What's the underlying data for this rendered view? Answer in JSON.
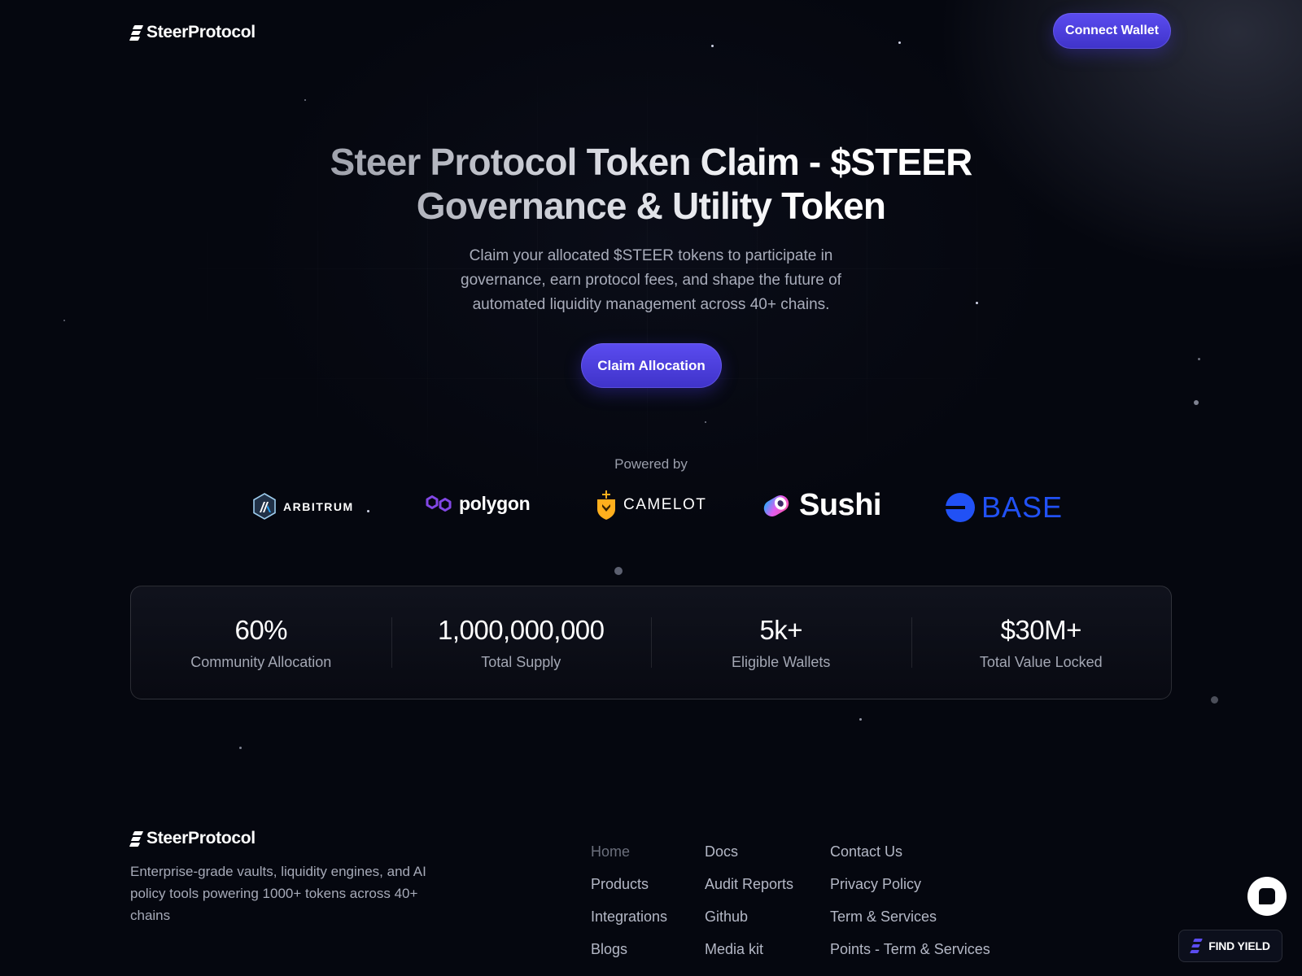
{
  "header": {
    "logo_text": "SteerProtocol",
    "connect_label": "Connect Wallet"
  },
  "hero": {
    "title_line1": "Steer Protocol Token Claim - $STEER",
    "title_line2": "Governance & Utility Token",
    "subtitle": "Claim your allocated $STEER tokens to participate in governance, earn protocol fees, and shape the future of automated liquidity management across 40+ chains.",
    "cta_label": "Claim Allocation"
  },
  "powered": {
    "label": "Powered by",
    "partners": [
      {
        "name": "ARBITRUM",
        "icon": "arbitrum-icon",
        "color": "#ffffff"
      },
      {
        "name": "polygon",
        "icon": "polygon-icon",
        "color": "#8247e5"
      },
      {
        "name": "CAMELOT",
        "icon": "camelot-icon",
        "color": "#ffaf1d"
      },
      {
        "name": "Sushi",
        "icon": "sushi-icon",
        "color": "#e05df0"
      },
      {
        "name": "BASE",
        "icon": "base-icon",
        "color": "#2151f5"
      }
    ]
  },
  "stats": [
    {
      "value": "60%",
      "label": "Community Allocation"
    },
    {
      "value": "1,000,000,000",
      "label": "Total Supply"
    },
    {
      "value": "5k+",
      "label": "Eligible Wallets"
    },
    {
      "value": "$30M+",
      "label": "Total Value Locked"
    }
  ],
  "footer": {
    "logo_text": "SteerProtocol",
    "description": "Enterprise-grade vaults, liquidity engines, and AI policy tools powering 1000+ tokens across 40+ chains",
    "col1": [
      "Home",
      "Products",
      "Integrations",
      "Blogs"
    ],
    "col2": [
      "Docs",
      "Audit Reports",
      "Github",
      "Media kit"
    ],
    "col3": [
      "Contact Us",
      "Privacy Policy",
      "Term & Services",
      "Points - Term & Services"
    ]
  },
  "widgets": {
    "find_yield_label": "FIND YIELD",
    "chat_icon": "chat-icon"
  },
  "colors": {
    "background": "#05070f",
    "accent": "#4f40e0"
  }
}
